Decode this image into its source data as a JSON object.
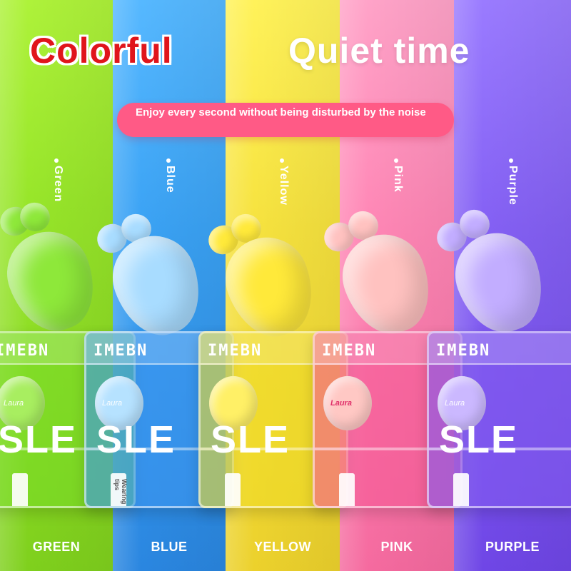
{
  "headline": {
    "left": "Colorful",
    "right": "Quiet time"
  },
  "banner": {
    "text": "Enjoy every second without being disturbed by the noise"
  },
  "colors": [
    {
      "name": "Green",
      "label": "GREEN",
      "hex": "#98e62a",
      "plug": "#8ee83a"
    },
    {
      "name": "Blue",
      "label": "BLUE",
      "hex": "#3aa2f4",
      "plug": "#a8dcff"
    },
    {
      "name": "Yellow",
      "label": "YELLOW",
      "hex": "#f6e23e",
      "plug": "#ffe93a"
    },
    {
      "name": "Pink",
      "label": "PINK",
      "hex": "#ff86b5",
      "plug": "#ffc2c0"
    },
    {
      "name": "Purple",
      "label": "PURPLE",
      "hex": "#8460f4",
      "plug": "#c2adff"
    }
  ],
  "box": {
    "brand": "IMEBN",
    "model_text": "SLE",
    "name_text": "Laura",
    "tips_label": "Wearing tips"
  }
}
